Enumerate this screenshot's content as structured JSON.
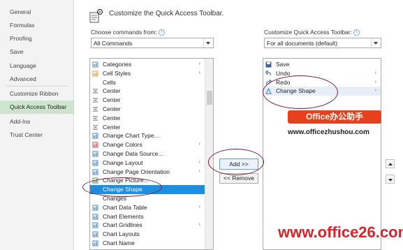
{
  "nav": {
    "items": [
      "General",
      "Formulas",
      "Proofing",
      "Save",
      "Language",
      "Advanced",
      "Customize Ribbon",
      "Quick Access Toolbar",
      "Add-Ins",
      "Trust Center"
    ],
    "selected": "Quick Access Toolbar"
  },
  "header": {
    "title": "Customize the Quick Access Toolbar."
  },
  "choose": {
    "label": "Choose commands from:",
    "info": "i",
    "value": "All Commands"
  },
  "customize": {
    "label": "Customize Quick Access Toolbar:",
    "info": "i",
    "value": "For all documents (default)"
  },
  "commands": [
    {
      "label": "Categories",
      "icon": "categories-icon",
      "sub": "›"
    },
    {
      "label": "Cell Styles",
      "icon": "cell-styles-icon",
      "sub": "›"
    },
    {
      "label": "Cells",
      "icon": "",
      "sub": ""
    },
    {
      "label": "Center",
      "icon": "center-icon",
      "sub": ""
    },
    {
      "label": "Center",
      "icon": "center-icon",
      "sub": ""
    },
    {
      "label": "Center",
      "icon": "center-icon",
      "sub": ""
    },
    {
      "label": "Center",
      "icon": "center-icon",
      "sub": ""
    },
    {
      "label": "Center",
      "icon": "center-icon",
      "sub": ""
    },
    {
      "label": "Change Chart Type...",
      "icon": "chart-type-icon",
      "sub": ""
    },
    {
      "label": "Change Colors",
      "icon": "colors-icon",
      "sub": "›"
    },
    {
      "label": "Change Data Source...",
      "icon": "data-source-icon",
      "sub": ""
    },
    {
      "label": "Change Layout",
      "icon": "layout-icon",
      "sub": "›"
    },
    {
      "label": "Change Page Orientation",
      "icon": "orientation-icon",
      "sub": "›"
    },
    {
      "label": "Change Picture...",
      "icon": "picture-icon",
      "sub": ""
    },
    {
      "label": "Change Shape",
      "icon": "shape-icon",
      "sub": "›"
    },
    {
      "label": "Changes",
      "icon": "",
      "sub": ""
    },
    {
      "label": "Chart Data Table",
      "icon": "data-table-icon",
      "sub": "›"
    },
    {
      "label": "Chart Elements",
      "icon": "chart-elements-icon",
      "sub": ""
    },
    {
      "label": "Chart Gridlines",
      "icon": "gridlines-icon",
      "sub": "›"
    },
    {
      "label": "Chart Layouts",
      "icon": "chart-layouts-icon",
      "sub": ""
    },
    {
      "label": "Chart Name",
      "icon": "chart-name-icon",
      "sub": ""
    }
  ],
  "commands_selected": "Change Shape",
  "toolbar_items": [
    {
      "label": "Save",
      "icon": "save-icon",
      "sub": ""
    },
    {
      "label": "Undo",
      "icon": "undo-icon",
      "sub": "›"
    },
    {
      "label": "Redo",
      "icon": "redo-icon",
      "sub": "›"
    },
    {
      "label": "Change Shape",
      "icon": "shape-icon",
      "sub": "›"
    }
  ],
  "buttons": {
    "add": "Add >>",
    "remove": "<< Remove"
  },
  "watermarks": {
    "badge": "Office办公助手",
    "url1": "www.officezhushou.com",
    "url2": "www.office26.com"
  },
  "colors": {
    "nav_selected": "#cde5cd",
    "list_selected": "#1e8ee0",
    "ring": "#7a1d3a",
    "badge": "#e8401c",
    "url2": "#d8232a"
  }
}
